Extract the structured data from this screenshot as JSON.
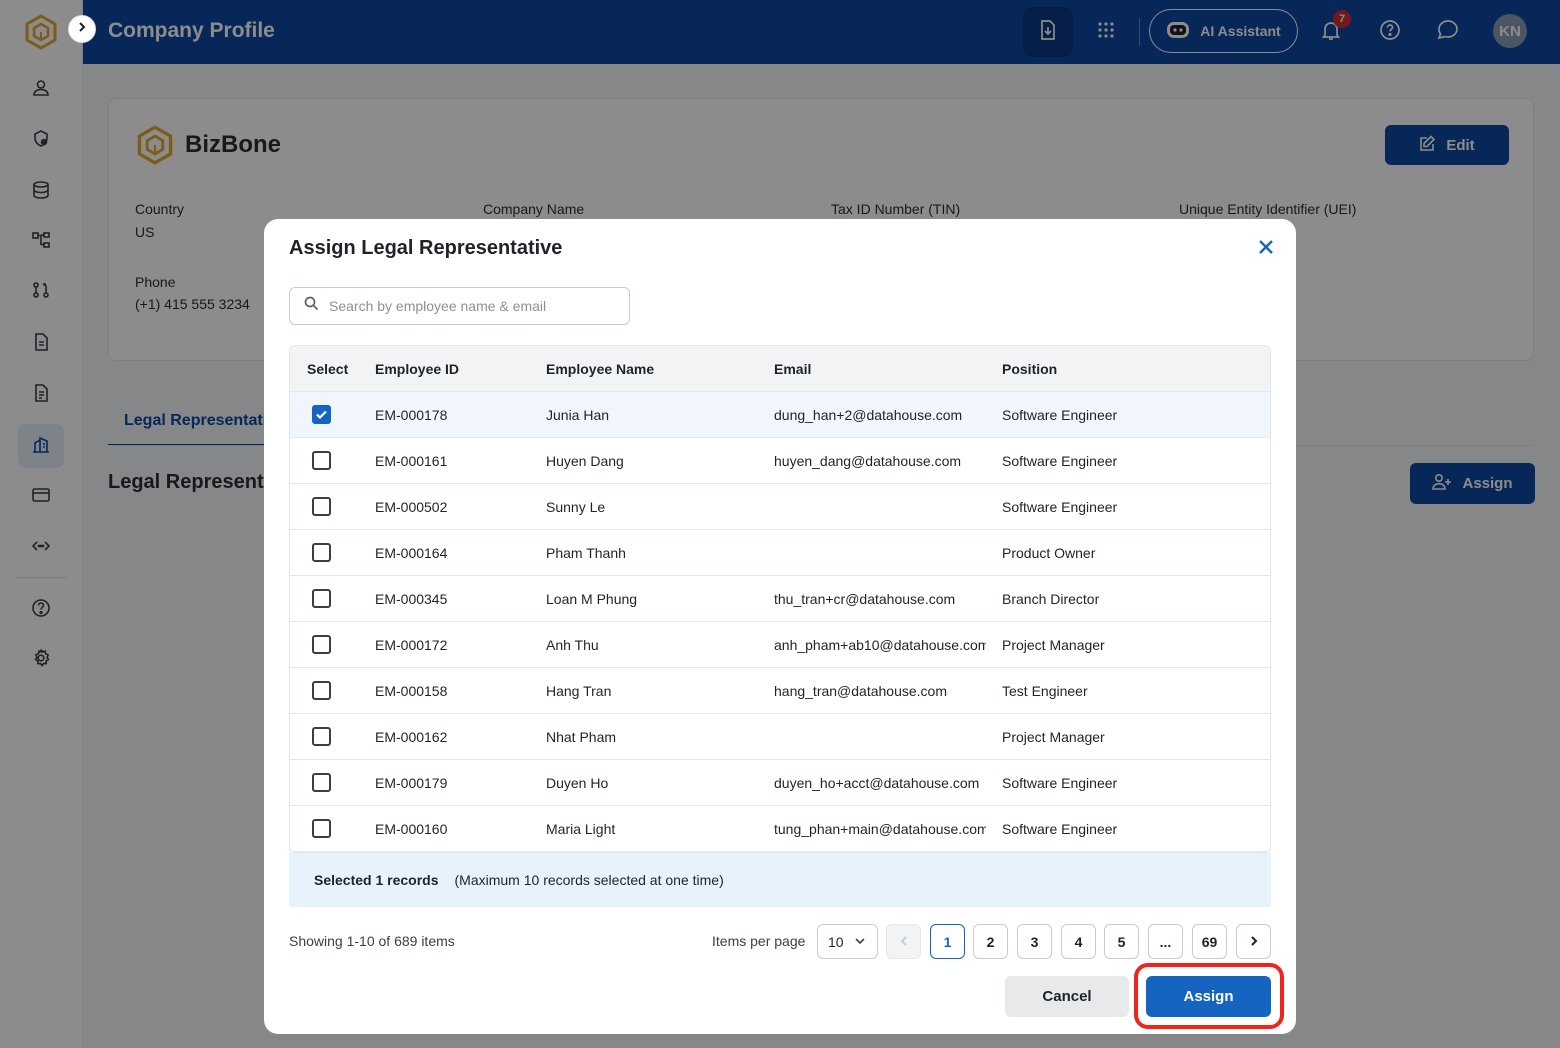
{
  "header": {
    "title": "Company Profile",
    "ai_label": "AI Assistant",
    "notification_count": "7",
    "avatar_initials": "KN"
  },
  "sidebar": {
    "items": [
      {
        "icon": "user-icon"
      },
      {
        "icon": "shield-user-icon"
      },
      {
        "icon": "database-icon"
      },
      {
        "icon": "hierarchy-icon"
      },
      {
        "icon": "workflow-icon"
      },
      {
        "icon": "document-icon"
      },
      {
        "icon": "document-list-icon"
      },
      {
        "icon": "company-icon",
        "active": true
      },
      {
        "icon": "credit-card-icon"
      },
      {
        "icon": "api-icon"
      },
      {
        "icon": "help-icon"
      },
      {
        "icon": "settings-icon"
      }
    ]
  },
  "company": {
    "brand_name": "BizBone",
    "edit_label": "Edit",
    "fields": {
      "country_label": "Country",
      "country_value": "US",
      "company_name_label": "Company Name",
      "tin_label": "Tax ID Number (TIN)",
      "uei_label": "Unique Entity Identifier (UEI)",
      "phone_label": "Phone",
      "phone_value": "(+1) 415 555 3234"
    }
  },
  "page": {
    "tab_label": "Legal Representative",
    "section_title": "Legal Representative",
    "assign_label": "Assign"
  },
  "modal": {
    "title": "Assign Legal Representative",
    "search_placeholder": "Search by employee name & email",
    "columns": {
      "select": "Select",
      "employee_id": "Employee ID",
      "employee_name": "Employee Name",
      "email": "Email",
      "position": "Position"
    },
    "rows": [
      {
        "id": "EM-000178",
        "name": "Junia Han",
        "email": "dung_han+2@datahouse.com",
        "position": "Software Engineer",
        "checked": true
      },
      {
        "id": "EM-000161",
        "name": "Huyen Dang",
        "email": "huyen_dang@datahouse.com",
        "position": "Software Engineer",
        "checked": false
      },
      {
        "id": "EM-000502",
        "name": "Sunny Le",
        "email": "",
        "position": "Software Engineer",
        "checked": false
      },
      {
        "id": "EM-000164",
        "name": "Pham Thanh",
        "email": "",
        "position": "Product Owner",
        "checked": false
      },
      {
        "id": "EM-000345",
        "name": "Loan M Phung",
        "email": "thu_tran+cr@datahouse.com",
        "position": "Branch Director",
        "checked": false
      },
      {
        "id": "EM-000172",
        "name": "Anh Thu",
        "email": "anh_pham+ab10@datahouse.com",
        "position": "Project Manager",
        "checked": false
      },
      {
        "id": "EM-000158",
        "name": "Hang Tran",
        "email": "hang_tran@datahouse.com",
        "position": "Test Engineer",
        "checked": false
      },
      {
        "id": "EM-000162",
        "name": "Nhat Pham",
        "email": "",
        "position": "Project Manager",
        "checked": false
      },
      {
        "id": "EM-000179",
        "name": "Duyen Ho",
        "email": "duyen_ho+acct@datahouse.com",
        "position": "Software Engineer",
        "checked": false
      },
      {
        "id": "EM-000160",
        "name": "Maria Light",
        "email": "tung_phan+main@datahouse.com",
        "position": "Software Engineer",
        "checked": false
      }
    ],
    "selected_count_text": "Selected 1 records",
    "selected_note": "(Maximum 10 records selected at one time)",
    "showing_text": "Showing 1-10 of 689 items",
    "items_per_page_label": "Items per page",
    "items_per_page_value": "10",
    "pages": [
      "1",
      "2",
      "3",
      "4",
      "5",
      "...",
      "69"
    ],
    "current_page": "1",
    "cancel_label": "Cancel",
    "assign_label": "Assign"
  },
  "colors": {
    "primary": "#0d47a1",
    "accent": "#1565c0",
    "highlight": "#f0241a",
    "brand_gold": "#e0a82e"
  }
}
